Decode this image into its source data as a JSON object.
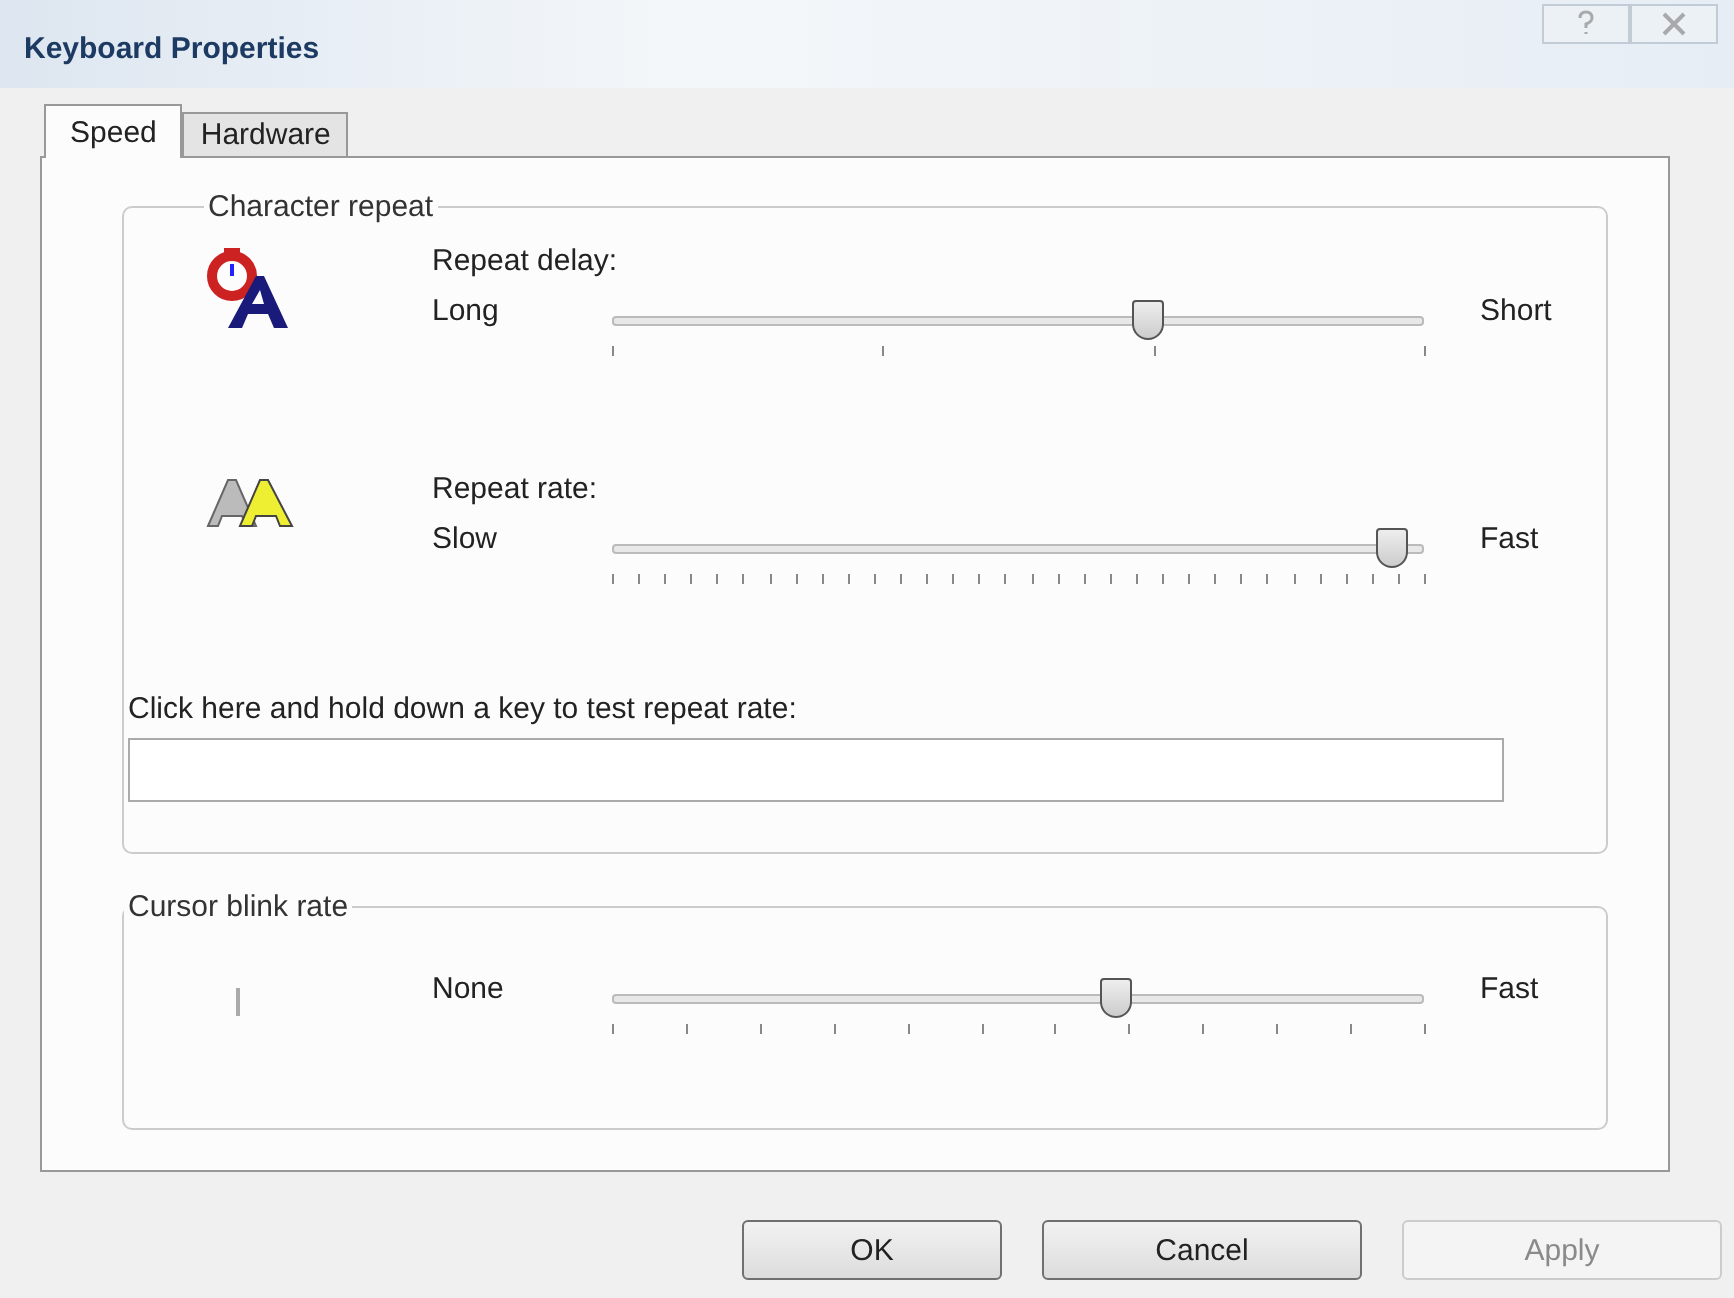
{
  "window": {
    "title": "Keyboard Properties"
  },
  "title_buttons": [
    {
      "kind": "help",
      "disabled": true
    },
    {
      "kind": "close",
      "disabled": true
    }
  ],
  "tabs": [
    {
      "label": "Speed",
      "selected": true
    },
    {
      "label": "Hardware",
      "selected": false
    }
  ],
  "character_repeat": {
    "title": "Character repeat",
    "sliders": [
      {
        "kind": "delay",
        "label": "Repeat delay:",
        "min_label": "Long",
        "max_label": "Short",
        "level": 0.66
      },
      {
        "kind": "rate",
        "label": "Repeat rate:",
        "min_label": "Slow",
        "max_label": "Fast",
        "level": 0.96
      }
    ],
    "test_field": {
      "label": "Click here and hold down a key to test repeat rate:"
    }
  },
  "cursor_blink_rate": {
    "title": "Cursor blink rate",
    "min_label": "None",
    "max_label": "Fast",
    "level": 0.62
  },
  "buttons": [
    {
      "label": "OK",
      "disabled": false
    },
    {
      "label": "Cancel",
      "disabled": false
    },
    {
      "label": "Apply",
      "disabled": true
    }
  ]
}
